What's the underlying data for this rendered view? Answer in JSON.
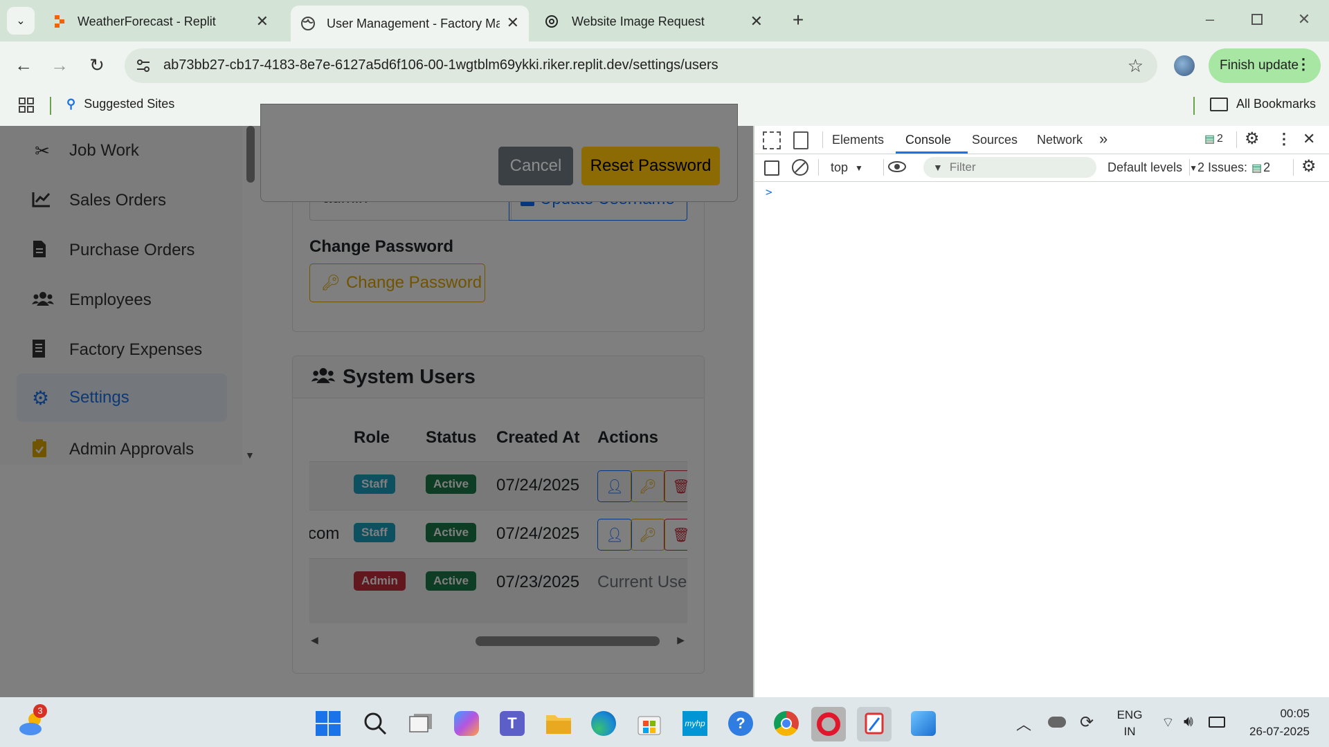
{
  "browser": {
    "tabs": [
      {
        "title": "WeatherForecast - Replit",
        "icon": "replit-icon"
      },
      {
        "title": "User Management - Factory Ma",
        "icon": "globe-icon"
      },
      {
        "title": "Website Image Request",
        "icon": "chatgpt-icon"
      }
    ],
    "url": "ab73bb27-cb17-4183-8e7e-6127a5d6f106-00-1wgtblm69ykki.riker.replit.dev/settings/users",
    "finish_update": "Finish update",
    "suggested_sites": "Suggested Sites",
    "all_bookmarks": "All Bookmarks"
  },
  "sidebar": {
    "items": [
      {
        "label": "Job Work",
        "icon": "tools-icon"
      },
      {
        "label": "Sales Orders",
        "icon": "chart-line-icon"
      },
      {
        "label": "Purchase Orders",
        "icon": "file-icon"
      },
      {
        "label": "Employees",
        "icon": "users-icon"
      },
      {
        "label": "Factory Expenses",
        "icon": "receipt-icon"
      },
      {
        "label": "Settings",
        "icon": "gear-icon"
      },
      {
        "label": "Admin Approvals",
        "icon": "clipboard-check-icon"
      }
    ],
    "active": "Settings"
  },
  "modal": {
    "cancel": "Cancel",
    "reset_password": "Reset Password"
  },
  "account": {
    "username_value": "admin",
    "update_username": "Update Username",
    "change_password_heading": "Change Password",
    "change_password_button": "Change Password"
  },
  "system_users": {
    "title": "System Users",
    "columns": [
      "Role",
      "Status",
      "Created At",
      "Actions"
    ],
    "rows": [
      {
        "email_fragment": "",
        "role": "Staff",
        "status": "Active",
        "created": "07/24/2025",
        "actions": "buttons"
      },
      {
        "email_fragment": "com",
        "role": "Staff",
        "status": "Active",
        "created": "07/24/2025",
        "actions": "buttons"
      },
      {
        "email_fragment": "",
        "role": "Admin",
        "status": "Active",
        "created": "07/23/2025",
        "actions": "Current User"
      }
    ]
  },
  "devtools": {
    "tabs": [
      "Elements",
      "Console",
      "Sources",
      "Network"
    ],
    "active_tab": "Console",
    "issues_count": "2",
    "context": "top",
    "filter_placeholder": "Filter",
    "levels": "Default levels",
    "issues_label": "2 Issues:",
    "issues_badge": "2",
    "prompt": ">"
  },
  "taskbar": {
    "weather_badge": "3",
    "lang_top": "ENG",
    "lang_bottom": "IN",
    "time": "00:05",
    "date": "26-07-2025"
  },
  "colors": {
    "staff": "#1aa2c2",
    "active": "#1d7a4a",
    "admin": "#c42d3b",
    "warning": "#e0a800",
    "primary": "#0d6efd"
  }
}
